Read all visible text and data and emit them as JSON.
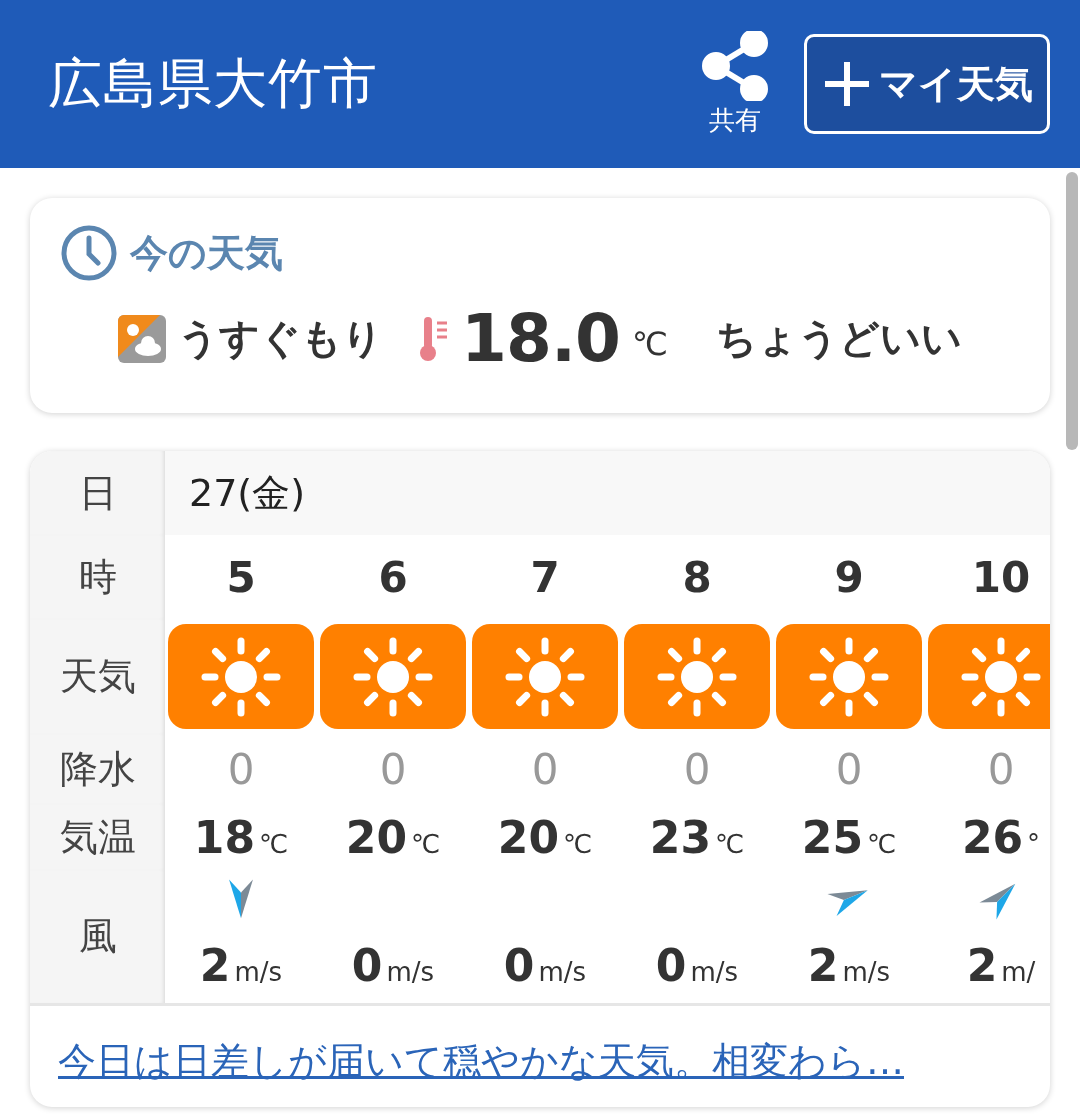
{
  "header": {
    "title": "広島県大竹市",
    "share_label": "共有",
    "my_weather_button": "マイ天気"
  },
  "current": {
    "heading": "今の天気",
    "condition": "うすぐもり",
    "temperature": "18.0",
    "unit": "℃",
    "feeling": "ちょうどいい"
  },
  "forecast": {
    "row_labels": [
      "日",
      "時",
      "天気",
      "降水",
      "気温",
      "風"
    ],
    "date": "27(金)",
    "hours": [
      {
        "hour": "5",
        "kind": "sunny",
        "precipitation": "0",
        "temperature": "18",
        "temperature_unit": "℃",
        "wind_arrow": {
          "kind": "south"
        },
        "wind_speed": "2",
        "wind_unit": "m/s"
      },
      {
        "hour": "6",
        "kind": "sunny",
        "precipitation": "0",
        "temperature": "20",
        "temperature_unit": "℃",
        "wind_speed": "0",
        "wind_unit": "m/s"
      },
      {
        "hour": "7",
        "kind": "sunny",
        "precipitation": "0",
        "temperature": "20",
        "temperature_unit": "℃",
        "wind_speed": "0",
        "wind_unit": "m/s"
      },
      {
        "hour": "8",
        "kind": "sunny",
        "precipitation": "0",
        "temperature": "23",
        "temperature_unit": "℃",
        "wind_speed": "0",
        "wind_unit": "m/s"
      },
      {
        "hour": "9",
        "kind": "sunny",
        "precipitation": "0",
        "temperature": "25",
        "temperature_unit": "℃",
        "wind_arrow": {
          "kind": "eastnortheast"
        },
        "wind_speed": "2",
        "wind_unit": "m/s"
      },
      {
        "hour": "10",
        "kind": "sunny",
        "precipitation": "0",
        "temperature": "26",
        "temperature_unit": "°",
        "wind_arrow": {
          "kind": "northeast"
        },
        "wind_speed": "2",
        "wind_unit": "m/"
      }
    ]
  },
  "summary_link": "今日は日差しが届いて穏やかな天気。相変わら…"
}
